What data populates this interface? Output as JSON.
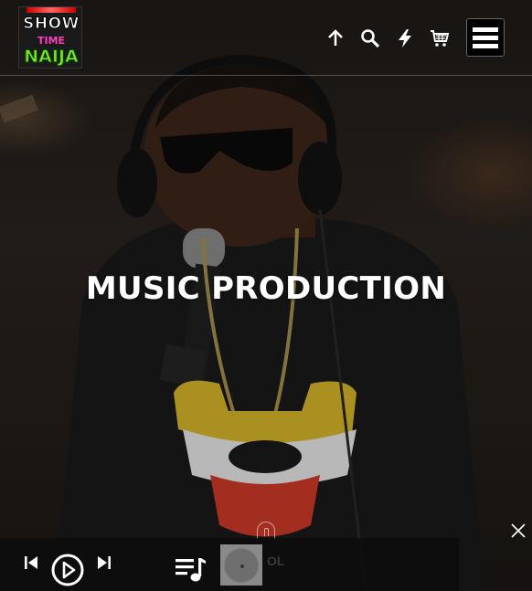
{
  "header": {
    "logo": {
      "line1": "SHOW",
      "line2": "TIME",
      "line3": "NAIJA"
    },
    "icons": [
      "arrow-up-icon",
      "search-icon",
      "lightning-icon",
      "cart-icon"
    ],
    "menu_icon": "hamburger-menu-icon"
  },
  "hero": {
    "title": "MUSIC PRODUCTION"
  },
  "player": {
    "controls": [
      "previous-icon",
      "play-icon",
      "next-icon",
      "playlist-icon"
    ],
    "track_text": "OL",
    "close_icon": "close-icon"
  },
  "colors": {
    "accent_pink": "#ff3dbe",
    "accent_green": "#7be52a",
    "text": "#ffffff"
  }
}
